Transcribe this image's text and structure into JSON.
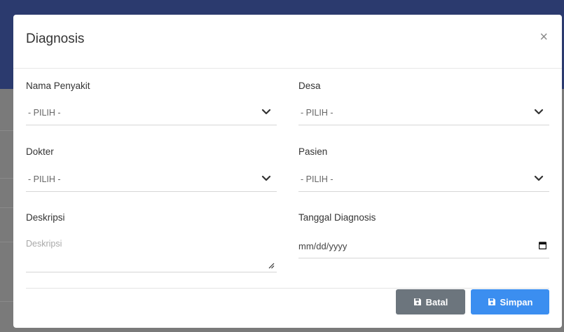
{
  "modal": {
    "title": "Diagnosis",
    "close_glyph": "×"
  },
  "form": {
    "nama_penyakit": {
      "label": "Nama Penyakit",
      "value": "- PILIH -"
    },
    "desa": {
      "label": "Desa",
      "value": "- PILIH -"
    },
    "dokter": {
      "label": "Dokter",
      "value": "- PILIH -"
    },
    "pasien": {
      "label": "Pasien",
      "value": "- PILIH -"
    },
    "deskripsi": {
      "label": "Deskripsi",
      "placeholder": "Deskripsi"
    },
    "tanggal_diagnosis": {
      "label": "Tanggal Diagnosis",
      "value": "mm/dd/yyyy"
    }
  },
  "buttons": {
    "batal": {
      "label": "Batal"
    },
    "simpan": {
      "label": "Simpan"
    }
  },
  "icons": {
    "select_arrow": "chevron-down-icon",
    "date_picker": "calendar-icon",
    "button_icon": "floppy-disk-icon"
  },
  "colors": {
    "batal_button": "#6c757d",
    "simpan_button": "#3b8ef0",
    "page_header_background": "#2b3a6e",
    "overlay": "#7a7a7a"
  }
}
